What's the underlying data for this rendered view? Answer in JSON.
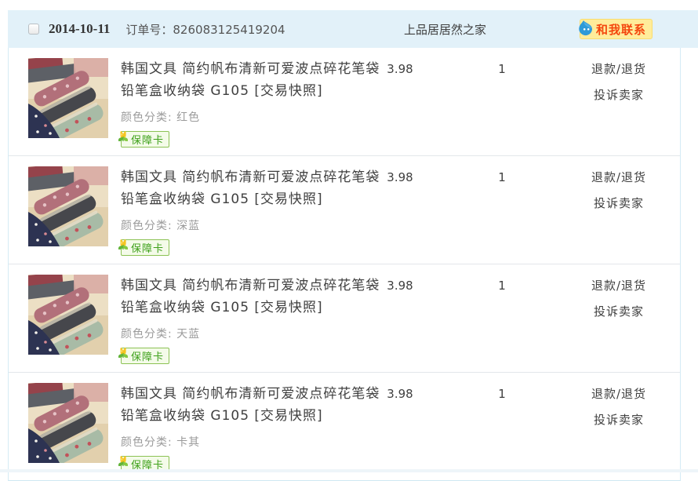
{
  "header": {
    "date": "2014-10-11",
    "order_label": "订单号：",
    "order_number": "826083125419204",
    "order_text": "订单号：826083125419204",
    "shop_name": "上品居居然之家",
    "contact_label": "和我联系",
    "checkbox_checked": false
  },
  "icons": {
    "contact_icon": "wangwang-droplet",
    "badge_icon": "tulip-flower",
    "thumbnail": "fabric-pencil-case-photo"
  },
  "colors": {
    "header_bg": "#e2f1f9",
    "card_border": "#d5ebf5",
    "row_separator": "#e3e7ea",
    "text_dark": "#3f3f3f",
    "text_muted": "#9b9b9b",
    "badge_green": "#3da019",
    "badge_border": "#8cc254",
    "contact_bg": "#ffec9a",
    "contact_red": "#f4460d",
    "wangwang_blue": "#2f9ad8"
  },
  "rows": [
    {
      "title": "韩国文具 简约帆布清新可爱波点碎花笔袋 铅笔盒收纳袋 G105 [交易快照]",
      "sku_label": "颜色分类: ",
      "sku_value": "红色",
      "badge": "保障卡",
      "price": "3.98",
      "quantity": "1",
      "action_refund": "退款/退货",
      "action_complaint": "投诉卖家"
    },
    {
      "title": "韩国文具 简约帆布清新可爱波点碎花笔袋 铅笔盒收纳袋 G105 [交易快照]",
      "sku_label": "颜色分类: ",
      "sku_value": "深蓝",
      "badge": "保障卡",
      "price": "3.98",
      "quantity": "1",
      "action_refund": "退款/退货",
      "action_complaint": "投诉卖家"
    },
    {
      "title": "韩国文具 简约帆布清新可爱波点碎花笔袋 铅笔盒收纳袋 G105 [交易快照]",
      "sku_label": "颜色分类: ",
      "sku_value": "天蓝",
      "badge": "保障卡",
      "price": "3.98",
      "quantity": "1",
      "action_refund": "退款/退货",
      "action_complaint": "投诉卖家"
    },
    {
      "title": "韩国文具 简约帆布清新可爱波点碎花笔袋 铅笔盒收纳袋 G105 [交易快照]",
      "sku_label": "颜色分类: ",
      "sku_value": "卡其",
      "badge": "保障卡",
      "price": "3.98",
      "quantity": "1",
      "action_refund": "退款/退货",
      "action_complaint": "投诉卖家"
    }
  ]
}
